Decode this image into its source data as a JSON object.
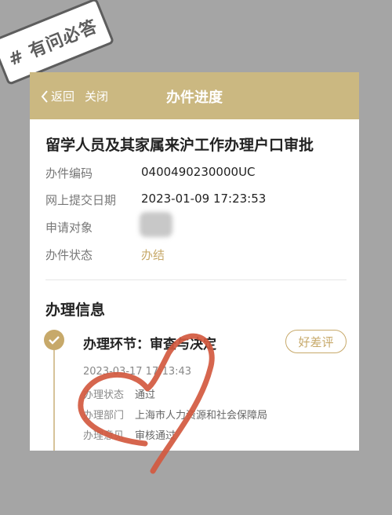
{
  "sticker": {
    "text": "# 有问必答"
  },
  "navbar": {
    "back_label": "返回",
    "close_label": "关闭",
    "title": "办件进度"
  },
  "case": {
    "title": "留学人员及其家属来沪工作办理户口审批",
    "rows": [
      {
        "label": "办件编码",
        "value": "0400490230000UC"
      },
      {
        "label": "网上提交日期",
        "value": "2023-01-09 17:23:53"
      },
      {
        "label": "申请对象",
        "value": ""
      },
      {
        "label": "办件状态",
        "value": "办结"
      }
    ]
  },
  "processing": {
    "section_title": "办理信息",
    "step": {
      "title": "办理环节：审查与决定",
      "rate_label": "好差评",
      "time": "2023-03-17 17:13:43",
      "details": [
        {
          "label": "办理状态",
          "value": "通过"
        },
        {
          "label": "办理部门",
          "value": "上海市人力资源和社会保障局"
        },
        {
          "label": "办理意见",
          "value": "审核通过"
        }
      ]
    }
  },
  "colors": {
    "accent": "#c7a96a",
    "navbar": "#cbb881",
    "background": "#a5a5a5",
    "heart": "#d2593f"
  }
}
